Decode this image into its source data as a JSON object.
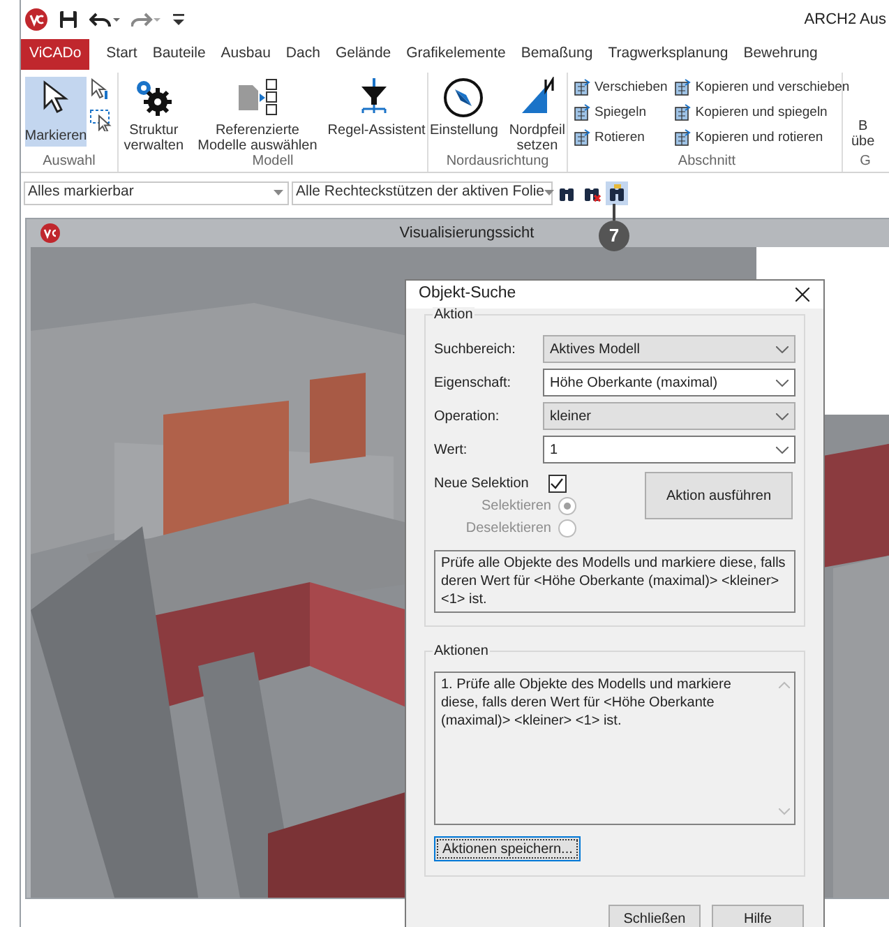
{
  "app": {
    "title": "ARCH2 Aus"
  },
  "tabs": [
    {
      "label": "ViCADo",
      "kind": "file"
    },
    {
      "label": "Start",
      "kind": "tab"
    },
    {
      "label": "Bauteile",
      "kind": "tab"
    },
    {
      "label": "Ausbau",
      "kind": "tab"
    },
    {
      "label": "Dach",
      "kind": "tab"
    },
    {
      "label": "Gelände",
      "kind": "tab"
    },
    {
      "label": "Grafikelemente",
      "kind": "tab"
    },
    {
      "label": "Bemaßung",
      "kind": "tab"
    },
    {
      "label": "Tragwerksplanung",
      "kind": "tab"
    },
    {
      "label": "Bewehrung",
      "kind": "tab"
    }
  ],
  "ribbon": {
    "select_tool": {
      "label": "Markieren",
      "selected": true
    },
    "groups": [
      {
        "label": "Auswahl",
        "kind": "select"
      },
      {
        "label": "Modell",
        "kind": "large",
        "items": [
          {
            "label": "Struktur verwalten",
            "kind": "gears"
          },
          {
            "label": "Referenzierte Modelle auswählen",
            "kind": "models"
          },
          {
            "label": "Regel-Assistent",
            "kind": "funnel"
          }
        ]
      },
      {
        "label": "Nordausrichtung",
        "kind": "large",
        "items": [
          {
            "label": "Einstellung",
            "kind": "compass"
          },
          {
            "label": "Nordpfeil setzen",
            "kind": "north"
          }
        ]
      },
      {
        "label": "Abschnitt",
        "kind": "small",
        "items": [
          {
            "label": "Verschieben"
          },
          {
            "label": "Kopieren und verschieben"
          },
          {
            "label": "Spiegeln"
          },
          {
            "label": "Kopieren und spiegeln"
          },
          {
            "label": "Rotieren"
          },
          {
            "label": "Kopieren und rotieren"
          }
        ]
      },
      {
        "label": "G",
        "kind": "cut",
        "items": [
          {
            "label": "B"
          },
          {
            "label": "übe"
          }
        ]
      }
    ]
  },
  "toolbar": {
    "selects": [
      {
        "value": "Alles markierbar"
      },
      {
        "value": "Alle Rechteckstützen der aktiven Folie"
      }
    ],
    "buttons": [
      {
        "kind": "find",
        "selected": false
      },
      {
        "kind": "find-clear",
        "selected": false
      },
      {
        "kind": "find-dialog",
        "selected": true
      }
    ]
  },
  "callout": "7",
  "viewer": {
    "title": "Visualisierungssicht"
  },
  "dialog": {
    "title": "Objekt-Suche",
    "aktion": {
      "label": "Aktion",
      "fields": [
        {
          "label": "Suchbereich:",
          "value": "Aktives Modell",
          "kind": "dropdown"
        },
        {
          "label": "Eigenschaft:",
          "value": "Höhe Oberkante (maximal)",
          "kind": "combo"
        },
        {
          "label": "Operation:",
          "value": "kleiner",
          "kind": "dropdown"
        },
        {
          "label": "Wert:",
          "value": "1",
          "kind": "combo"
        }
      ],
      "new_selection": {
        "label": "Neue Selektion",
        "checked": true
      },
      "radios": [
        {
          "label": "Selektieren",
          "selected": true,
          "disabled": true
        },
        {
          "label": "Deselektieren",
          "selected": false,
          "disabled": true
        }
      ],
      "execute": "Aktion ausführen",
      "description": "Prüfe alle Objekte des Modells und markiere diese, falls deren Wert für <Höhe Oberkante (maximal)> <kleiner> <1> ist."
    },
    "aktionen": {
      "label": "Aktionen",
      "list": [
        "1. Prüfe alle Objekte des Modells und markiere diese, falls deren Wert für <Höhe Oberkante (maximal)> <kleiner> <1> ist."
      ],
      "save": "Aktionen speichern..."
    },
    "buttons": [
      "Schließen",
      "Hilfe"
    ]
  }
}
